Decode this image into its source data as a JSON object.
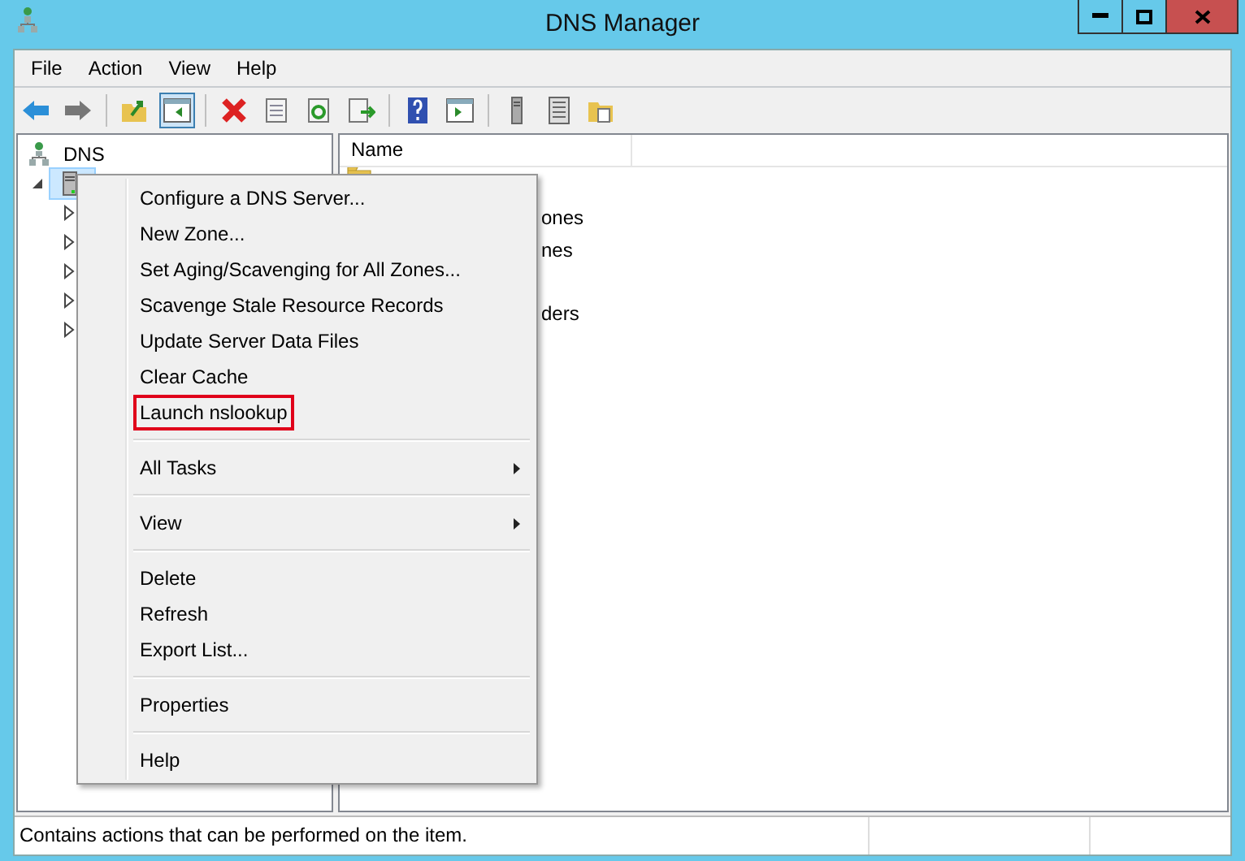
{
  "window": {
    "title": "DNS Manager"
  },
  "menu_bar": [
    "File",
    "Action",
    "View",
    "Help"
  ],
  "toolbar": [
    [
      {
        "kind": "back",
        "pressed": false
      },
      {
        "kind": "forward",
        "pressed": false
      }
    ],
    [
      {
        "kind": "up",
        "pressed": false
      },
      {
        "kind": "tree",
        "pressed": true
      }
    ],
    [
      {
        "kind": "delete",
        "pressed": false
      },
      {
        "kind": "properties",
        "pressed": false
      },
      {
        "kind": "refresh",
        "pressed": false
      },
      {
        "kind": "export",
        "pressed": false
      }
    ],
    [
      {
        "kind": "help",
        "pressed": false
      },
      {
        "kind": "pane",
        "pressed": false
      }
    ],
    [
      {
        "kind": "server",
        "pressed": false
      },
      {
        "kind": "list",
        "pressed": false
      },
      {
        "kind": "folder",
        "pressed": false
      }
    ]
  ],
  "tree": {
    "label": "DNS",
    "children": [
      {
        "selected": true,
        "expanded": true,
        "children": [
          {
            "expanded": false
          },
          {
            "expanded": false
          },
          {
            "expanded": false
          },
          {
            "expanded": false
          },
          {
            "expanded": false
          }
        ]
      }
    ]
  },
  "list": {
    "columns": [
      "Name"
    ],
    "rows": [
      {
        "kind": "folder",
        "text": null
      },
      {
        "kind": "text",
        "text": "ones"
      },
      {
        "kind": "text",
        "text": "nes"
      },
      {
        "kind": "blank",
        "text": null
      },
      {
        "kind": "text",
        "text": "ders"
      }
    ]
  },
  "context_menu": [
    [
      {
        "label": "Configure a DNS Server...",
        "submenu": false,
        "highlighted": false
      },
      {
        "label": "New Zone...",
        "submenu": false,
        "highlighted": false
      },
      {
        "label": "Set Aging/Scavenging for All Zones...",
        "submenu": false,
        "highlighted": false
      },
      {
        "label": "Scavenge Stale Resource Records",
        "submenu": false,
        "highlighted": false
      },
      {
        "label": "Update Server Data Files",
        "submenu": false,
        "highlighted": false
      },
      {
        "label": "Clear Cache",
        "submenu": false,
        "highlighted": false
      },
      {
        "label": "Launch nslookup",
        "submenu": false,
        "highlighted": true
      }
    ],
    [
      {
        "label": "All Tasks",
        "submenu": true,
        "highlighted": false
      }
    ],
    [
      {
        "label": "View",
        "submenu": true,
        "highlighted": false
      }
    ],
    [
      {
        "label": "Delete",
        "submenu": false,
        "highlighted": false
      },
      {
        "label": "Refresh",
        "submenu": false,
        "highlighted": false
      },
      {
        "label": "Export List...",
        "submenu": false,
        "highlighted": false
      }
    ],
    [
      {
        "label": "Properties",
        "submenu": false,
        "highlighted": false
      }
    ],
    [
      {
        "label": "Help",
        "submenu": false,
        "highlighted": false
      }
    ]
  ],
  "status_bar": "Contains actions that can be performed on the item."
}
